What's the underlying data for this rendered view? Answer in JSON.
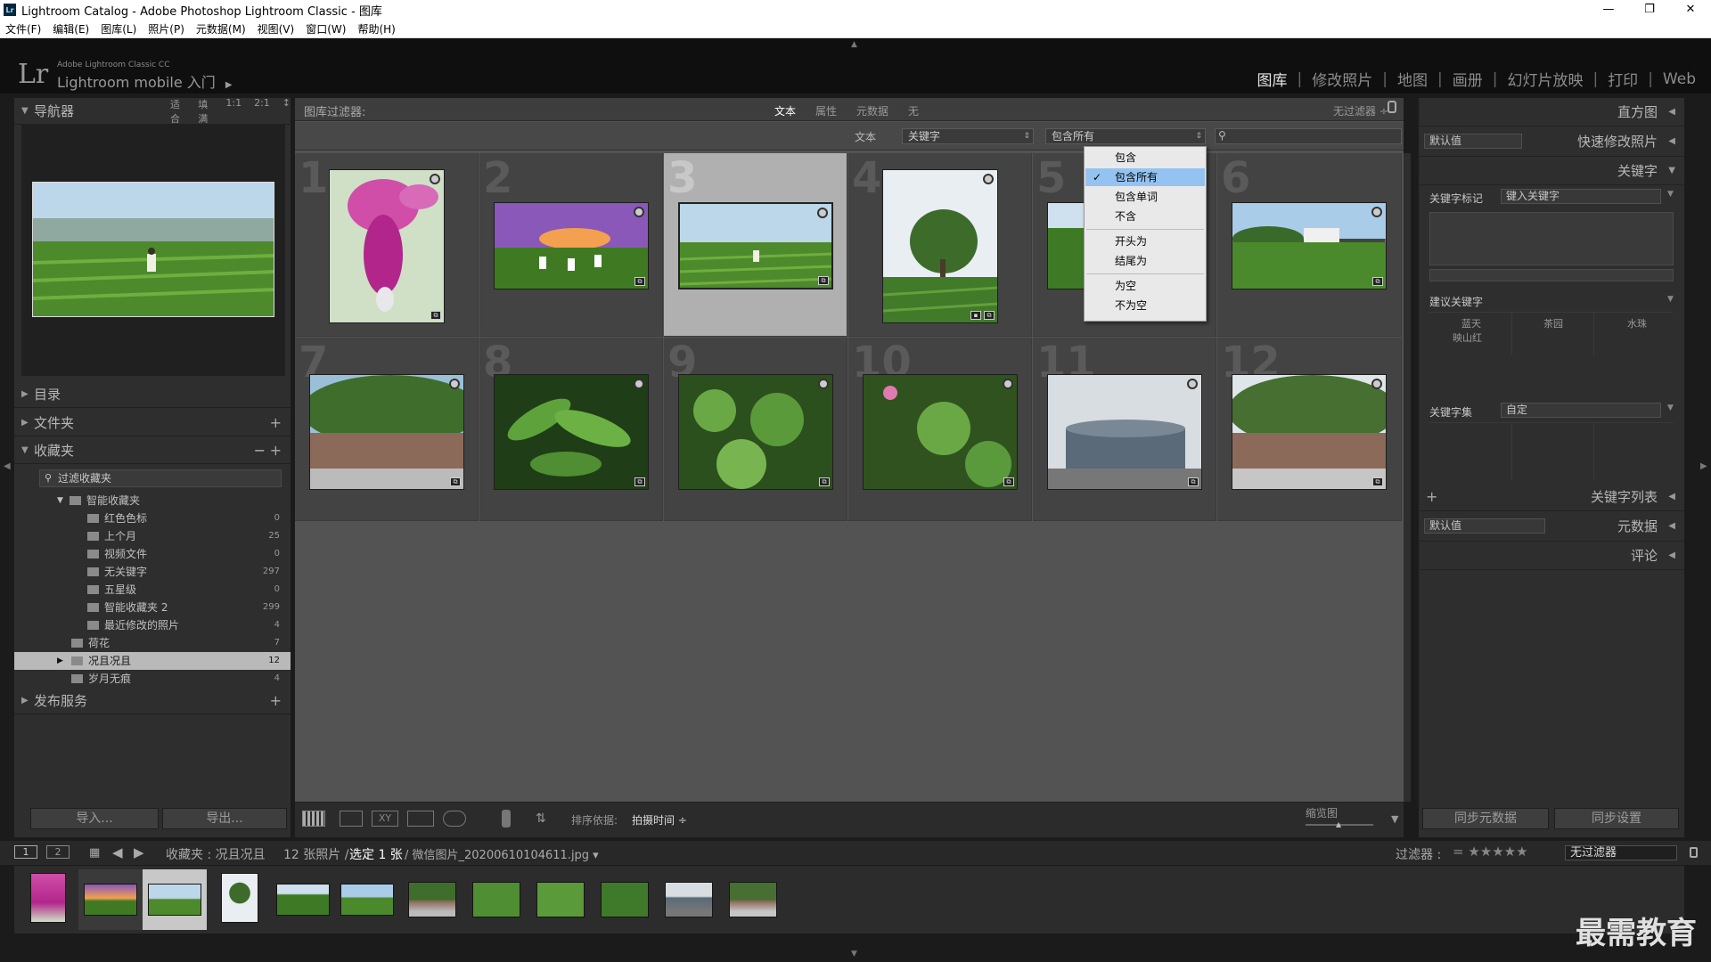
{
  "window": {
    "title": "Lightroom Catalog - Adobe Photoshop Lightroom Classic - 图库",
    "app_icon": "Lr",
    "controls": [
      "—",
      "❐",
      "✕"
    ]
  },
  "menu": [
    "文件(F)",
    "编辑(E)",
    "图库(L)",
    "照片(P)",
    "元数据(M)",
    "视图(V)",
    "窗口(W)",
    "帮助(H)"
  ],
  "identity": {
    "logo": "Lr",
    "small": "Adobe Lightroom Classic CC",
    "main": "Lightroom mobile 入门",
    "arrow": "▶"
  },
  "modules": [
    "图库",
    "修改照片",
    "地图",
    "画册",
    "幻灯片放映",
    "打印",
    "Web"
  ],
  "navigator": {
    "title": "导航器",
    "zoom_options": [
      "适合",
      "填满",
      "1:1",
      "2:1"
    ]
  },
  "left_sections": {
    "catalog": "目录",
    "folders": "文件夹",
    "collections": "收藏夹",
    "publish": "发布服务"
  },
  "collections": {
    "filter_placeholder": "过滤收藏夹",
    "smart_group": "智能收藏夹",
    "smart_items": [
      {
        "label": "红色色标",
        "count": "0"
      },
      {
        "label": "上个月",
        "count": "25"
      },
      {
        "label": "视频文件",
        "count": "0"
      },
      {
        "label": "无关键字",
        "count": "297"
      },
      {
        "label": "五星级",
        "count": "0"
      },
      {
        "label": "智能收藏夹 2",
        "count": "299"
      },
      {
        "label": "最近修改的照片",
        "count": "4"
      }
    ],
    "others": [
      {
        "label": "荷花",
        "count": "7"
      },
      {
        "label": "况且况且",
        "count": "12"
      },
      {
        "label": "岁月无痕",
        "count": "4"
      }
    ]
  },
  "left_buttons": {
    "import": "导入...",
    "export": "导出..."
  },
  "filter_bar": {
    "title": "图库过滤器:",
    "tabs": [
      "文本",
      "属性",
      "元数据",
      "无"
    ],
    "preset": "无过滤器 ÷",
    "row_label": "文本",
    "field": "关键字",
    "rule": "包含所有"
  },
  "dropdown": {
    "items": [
      "包含",
      "包含所有",
      "包含单词",
      "不含",
      "开头为",
      "结尾为",
      "为空",
      "不为空"
    ],
    "selected": "包含所有"
  },
  "grid": {
    "cell_numbers": [
      "1",
      "2",
      "3",
      "4",
      "5",
      "6",
      "7",
      "8",
      "9",
      "10",
      "11",
      "12"
    ],
    "selected_index": 3
  },
  "toolbar": {
    "sort_label": "排序依据:",
    "sort_value": "拍摄时间",
    "thumb_label": "缩览图"
  },
  "filmbar": {
    "pages": [
      "1",
      "2"
    ],
    "source": "收藏夹 : 况且况且",
    "info": "12 张照片 /",
    "selected": "选定 1 张",
    "file": "/ 微信图片_20200610104611.jpg ▾",
    "filter_label": "过滤器 :",
    "filter_value": "无过滤器",
    "stars": "= ★★★★★"
  },
  "right_panel": {
    "histogram": "直方图",
    "quick_develop": "快速修改照片",
    "quick_default": "默认值",
    "keywording": "关键字",
    "keyword_tags_label": "关键字标记",
    "keyword_tags_value": "键入关键字",
    "suggested_title": "建议关键字",
    "suggested": [
      "蓝天",
      "茶园",
      "水珠",
      "映山红"
    ],
    "keyword_set_label": "关键字集",
    "keyword_set_value": "自定",
    "keyword_list": "关键字列表",
    "metadata_default": "默认值",
    "metadata": "元数据",
    "comments": "评论",
    "sync_metadata": "同步元数据",
    "sync_settings": "同步设置"
  },
  "watermark": "最需教育"
}
